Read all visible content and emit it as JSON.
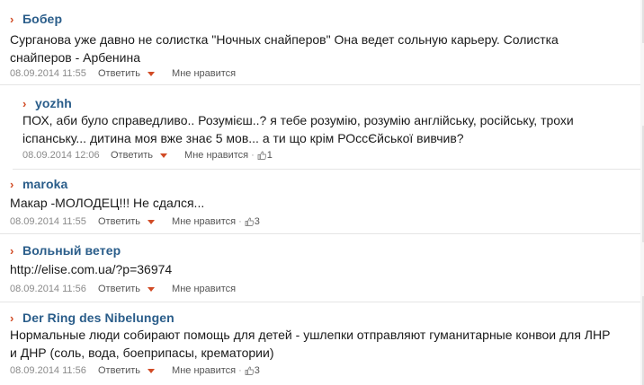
{
  "comments": [
    {
      "author": "Бобер",
      "lines": [
        "Сурганова уже давно не солистка \"Ночных снайперов\" Она ведет сольную карьеру. Солистка",
        "снайперов - Арбенина"
      ],
      "date": "08.09.2014 11:55",
      "reply": "Ответить",
      "dislike": "Мне нравится",
      "likes": ""
    },
    {
      "author": "yozhh",
      "lines": [
        "ПОХ, аби було справедливо.. Розумієш..? я тебе розумію, розумію англійську, російську, трохи",
        "іспанську... дитина моя вже знає 5 мов... а ти що крім РОссЄйської вивчив?"
      ],
      "date": "08.09.2014 12:06",
      "reply": "Ответить",
      "dislike": "Мне нравится",
      "likes": "1"
    },
    {
      "author": "maroka",
      "lines": [
        "Макар -МОЛОДЕЦ!!! Не сдался..."
      ],
      "date": "08.09.2014 11:55",
      "reply": "Ответить",
      "dislike": "Мне нравится",
      "likes": "3"
    },
    {
      "author": "Вольный ветер",
      "lines": [
        "http://elise.com.ua/?p=36974"
      ],
      "date": "08.09.2014 11:56",
      "reply": "Ответить",
      "dislike": "Мне нравится",
      "likes": ""
    },
    {
      "author": "Der Ring des Nibelungen",
      "lines": [
        "Нормальные люди собирают помощь для детей - ушлепки отправляют гуманитарные конвои для ЛНР",
        "и ДНР (соль, вода, боеприпасы, крематории)"
      ],
      "date": "08.09.2014 11:56",
      "reply": "Ответить",
      "dislike": "Мне нравится",
      "likes": "3"
    }
  ],
  "colors": {
    "author": "#2a5d8a",
    "accent": "#d14b25"
  },
  "icons": {
    "marker": "arrow-right-icon",
    "reply_menu": "caret-down-icon",
    "like": "thumbs-up-icon"
  }
}
